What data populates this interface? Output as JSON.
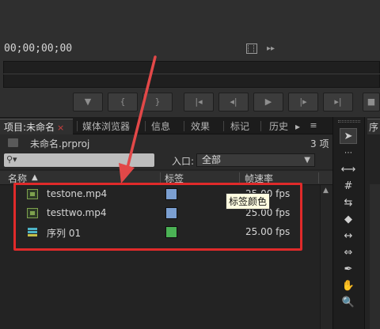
{
  "monitor": {
    "timecode": "00;00;00;00",
    "film_icon": "film-strip-icon",
    "audio_icon": "audio-waveform-icon",
    "transport_buttons": [
      "set-marker",
      "mark-in",
      "mark-out",
      "go-to-in",
      "step-back",
      "play",
      "step-forward",
      "go-to-out",
      "insert"
    ]
  },
  "tabs": [
    {
      "label": "项目:未命名",
      "close": "×"
    },
    {
      "label": "媒体浏览器"
    },
    {
      "label": "信息"
    },
    {
      "label": "效果"
    },
    {
      "label": "标记"
    },
    {
      "label": "历史"
    },
    {
      "label": "▸"
    }
  ],
  "tab_menu": "≡",
  "project": {
    "file_name": "未命名.prproj",
    "item_count": "3 项"
  },
  "search": {
    "placeholder": "",
    "inpoint_label": "入口:",
    "inpoint_value": "全部"
  },
  "columns": {
    "name": "名称",
    "sort": "▲",
    "label": "标签",
    "frame_rate": "帧速率"
  },
  "items": [
    {
      "name": "testone.mp4",
      "type": "video-clip-icon",
      "label_color": "#7b9fd1",
      "fps": "25.00 fps"
    },
    {
      "name": "testtwo.mp4",
      "type": "video-clip-icon",
      "label_color": "#7b9fd1",
      "fps": "25.00 fps"
    },
    {
      "name": "序列 01",
      "type": "sequence-icon",
      "label_color": "#4bb255",
      "fps": "25.00 fps"
    }
  ],
  "tooltip": "标签颜色",
  "right_tab": "序",
  "colors": {
    "highlight": "#e02a2a",
    "arrow": "#e24848"
  }
}
